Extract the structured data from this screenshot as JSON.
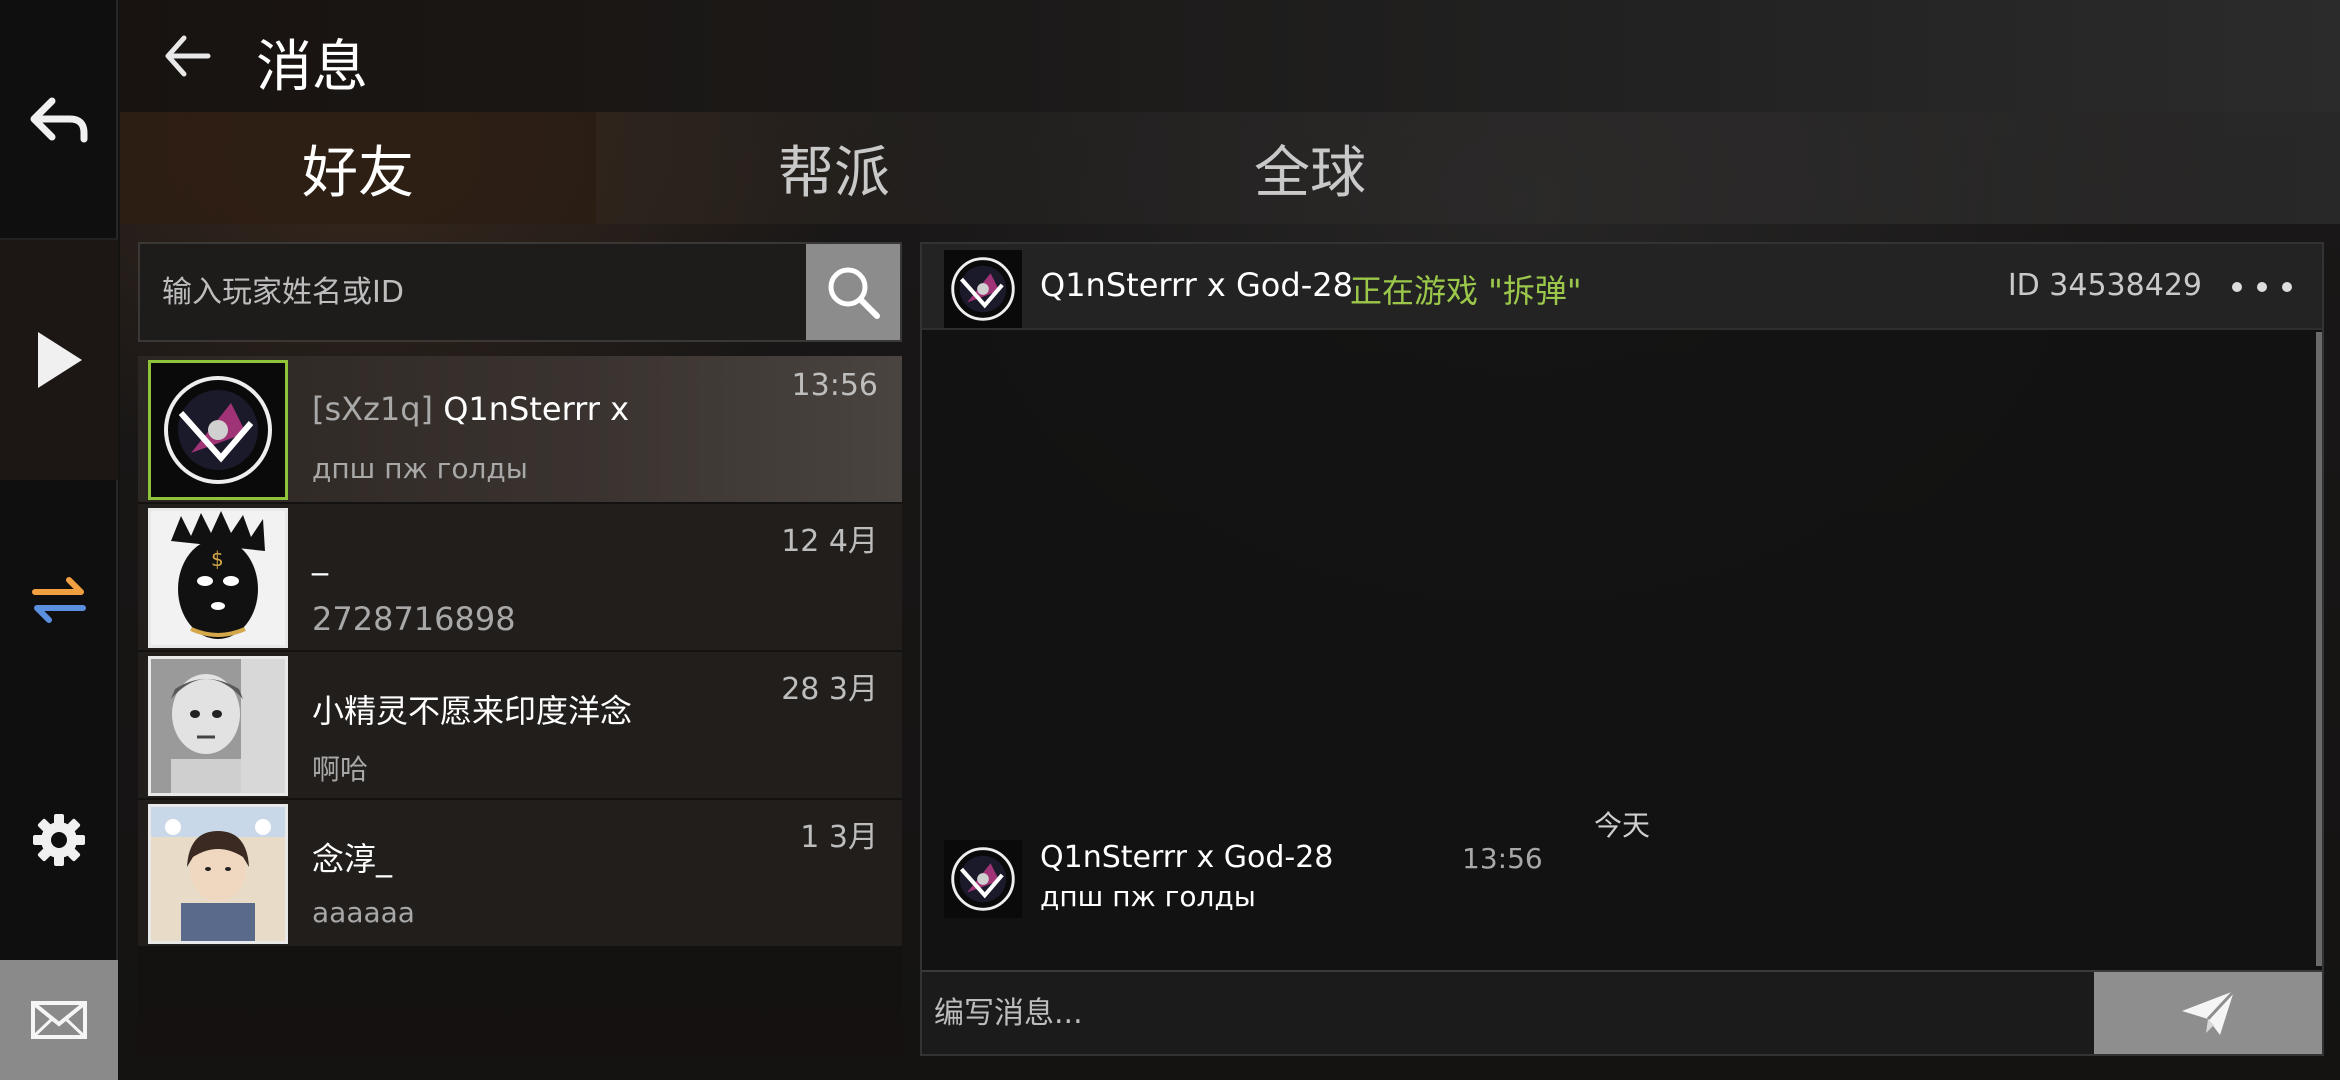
{
  "header": {
    "title": "消息",
    "back_icon": "arrow-left-icon"
  },
  "rail": {
    "items": [
      {
        "icon": "back-icon"
      },
      {
        "icon": "play-icon"
      },
      {
        "icon": "swap-arrows-icon"
      },
      {
        "icon": "gear-icon"
      },
      {
        "icon": "mail-icon",
        "active": true
      }
    ]
  },
  "tabs": [
    {
      "label": "好友",
      "active": true
    },
    {
      "label": "帮派",
      "active": false
    },
    {
      "label": "全球",
      "active": false
    }
  ],
  "search": {
    "placeholder": "输入玩家姓名或ID",
    "value": ""
  },
  "friends": [
    {
      "tag": "[sXz1q]",
      "name": "Q1nSterrr x",
      "subtitle": "дпш пж голды",
      "time": "13:56",
      "selected": true
    },
    {
      "tag": "",
      "name": "_",
      "subtitle": "2728716898",
      "time": "12 4月",
      "selected": false
    },
    {
      "tag": "",
      "name": "小精灵不愿来印度洋念",
      "subtitle": "啊哈",
      "time": "28 3月",
      "selected": false
    },
    {
      "tag": "",
      "name": "念淳_",
      "subtitle": "aaaaaa",
      "time": "1 3月",
      "selected": false
    }
  ],
  "chat": {
    "name": "Q1nSterrr x God-28",
    "status": "正在游戏 \"拆弹\"",
    "player_id": "ID 34538429",
    "day_label": "今天",
    "messages": [
      {
        "author": "Q1nSterrr x God-28",
        "time": "13:56",
        "text": "дпш пж голды"
      }
    ],
    "composer_placeholder": "编写消息...",
    "composer_value": ""
  },
  "colors": {
    "accent_green": "#8fc43a",
    "status_green": "#9bc84a",
    "button_gray": "#8c8c8c",
    "swap_icon_blue": "#5b8fe0",
    "swap_icon_orange": "#f0a040"
  }
}
